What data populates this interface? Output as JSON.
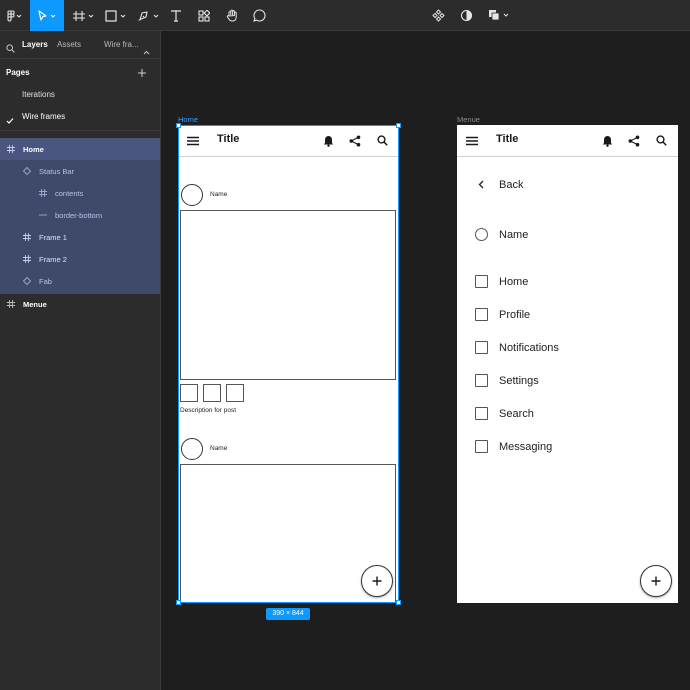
{
  "colors": {
    "accent": "#0d99ff",
    "panel": "#2c2c2c",
    "canvas": "#1e1e1e",
    "selection": "#3f4a6a"
  },
  "toolbar": {
    "tools": [
      "figma-menu-icon",
      "move-tool-icon",
      "frame-tool-icon",
      "shape-tool-icon",
      "pen-tool-icon",
      "text-tool-icon",
      "resources-icon",
      "hand-tool-icon",
      "comment-tool-icon",
      "component-icon",
      "mask-icon",
      "boolean-icon"
    ],
    "active_tool": "move-tool-icon"
  },
  "sidebar": {
    "tabs": {
      "layers": "Layers",
      "assets": "Assets",
      "page_switch": "Wire fra..."
    },
    "pages_header": "Pages",
    "pages": [
      {
        "label": "Iterations",
        "current": false
      },
      {
        "label": "Wire frames",
        "current": true
      }
    ],
    "layers": [
      {
        "label": "Home",
        "icon": "frame-icon",
        "level": 0,
        "selected": true
      },
      {
        "label": "Status Bar",
        "icon": "component-instance-icon",
        "level": 1
      },
      {
        "label": "contents",
        "icon": "frame-icon",
        "level": 2
      },
      {
        "label": "border-bottom",
        "icon": "line-icon",
        "level": 2
      },
      {
        "label": "Frame 1",
        "icon": "frame-icon",
        "level": 1
      },
      {
        "label": "Frame 2",
        "icon": "frame-icon",
        "level": 1
      },
      {
        "label": "Fab",
        "icon": "component-instance-icon",
        "level": 1
      },
      {
        "label": "Menue",
        "icon": "frame-icon",
        "level": 0
      }
    ]
  },
  "canvas": {
    "home_frame": {
      "label": "Home",
      "title": "Title",
      "posts": [
        {
          "name": "Name",
          "description": "Description for post"
        },
        {
          "name": "Name"
        }
      ],
      "size_badge": "390 × 844"
    },
    "menu_frame": {
      "label": "Menue",
      "title": "Title",
      "back_label": "Back",
      "user_name": "Name",
      "items": [
        "Home",
        "Profile",
        "Notifications",
        "Settings",
        "Search",
        "Messaging"
      ]
    }
  }
}
